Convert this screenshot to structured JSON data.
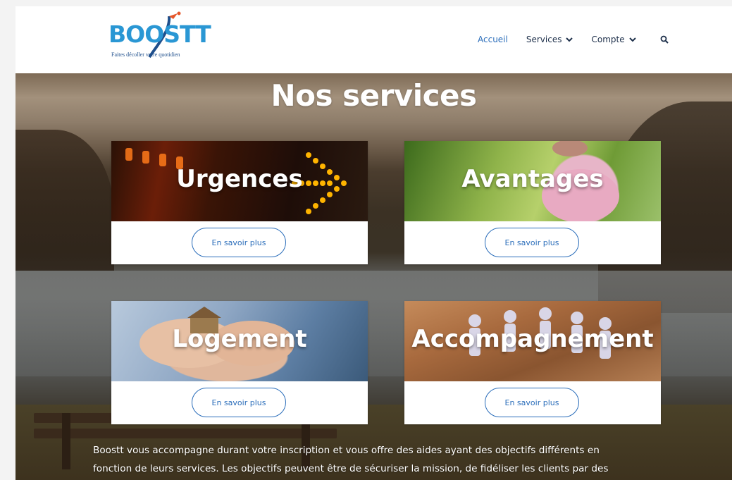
{
  "header": {
    "logo_text": "BOOSTT",
    "logo_tagline": "Faites décoller votre quotidien",
    "nav": [
      {
        "label": "Accueil",
        "active": true
      },
      {
        "label": "Services",
        "dropdown": true
      },
      {
        "label": "Compte",
        "dropdown": true
      }
    ],
    "search_icon": "search-icon"
  },
  "main": {
    "title": "Nos services",
    "cards": [
      {
        "title": "Urgences",
        "button": "En savoir plus"
      },
      {
        "title": "Avantages",
        "button": "En savoir plus"
      },
      {
        "title": "Logement",
        "button": "En savoir plus"
      },
      {
        "title": "Accompagnement",
        "button": "En savoir plus"
      }
    ],
    "description_line1": "Boostt vous accompagne durant votre inscription  et vous offre des aides ayant des objectifs différents en",
    "description_line2": "fonction de leurs services. Les objectifs peuvent être de sécuriser la mission, de fidéliser les clients par des"
  },
  "colors": {
    "accent": "#2a6dba",
    "logo_blue": "#2a97d4",
    "nav_text": "#1d2f4a"
  }
}
